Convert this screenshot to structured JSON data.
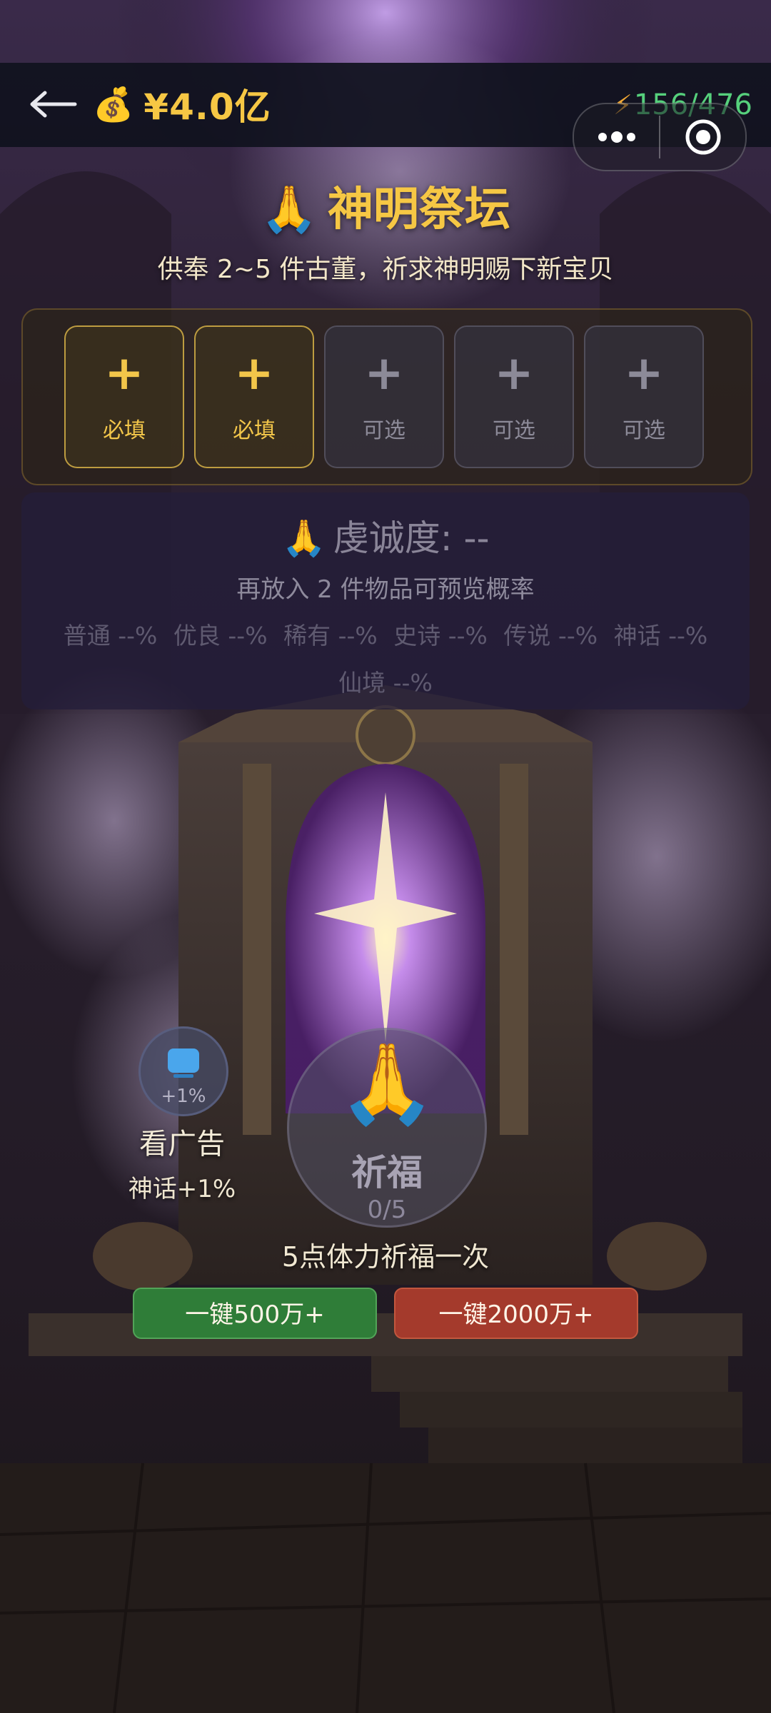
{
  "app": {
    "currency": "¥4.0亿",
    "currency_icon": "money-bag-icon",
    "energy": "156/476",
    "energy_icon": "lightning-icon"
  },
  "header": {
    "title_icon": "🙏",
    "title": "神明祭坛",
    "subtitle": "供奉 2~5 件古董，祈求神明赐下新宝贝"
  },
  "slots": [
    {
      "label": "必填",
      "icon": "+",
      "type": "required"
    },
    {
      "label": "必填",
      "icon": "+",
      "type": "required"
    },
    {
      "label": "可选",
      "icon": "+",
      "type": "optional"
    },
    {
      "label": "可选",
      "icon": "+",
      "type": "optional"
    },
    {
      "label": "可选",
      "icon": "+",
      "type": "optional"
    }
  ],
  "devotion": {
    "icon": "🙏",
    "title": "虔诚度: --",
    "hint": "再放入 2 件物品可预览概率",
    "rates": [
      "普通 --%",
      "优良 --%",
      "稀有 --%",
      "史诗 --%",
      "传说 --%",
      "神话 --%",
      "仙境 --%"
    ]
  },
  "ad": {
    "bonus": "+1%",
    "label": "看广告",
    "sub": "神话+1%"
  },
  "pray": {
    "icon": "🙏",
    "label": "祈福",
    "count": "0/5",
    "cost_hint": "5点体力祈福一次"
  },
  "quick": {
    "green_label": "一键500万+",
    "red_label": "一键2000万+"
  },
  "colors": {
    "gold": "#f6c744",
    "energy_green": "#56d07c",
    "quick_green": "#2f7d38",
    "quick_red": "#a43a2c",
    "panel_purple": "#241e3a"
  }
}
